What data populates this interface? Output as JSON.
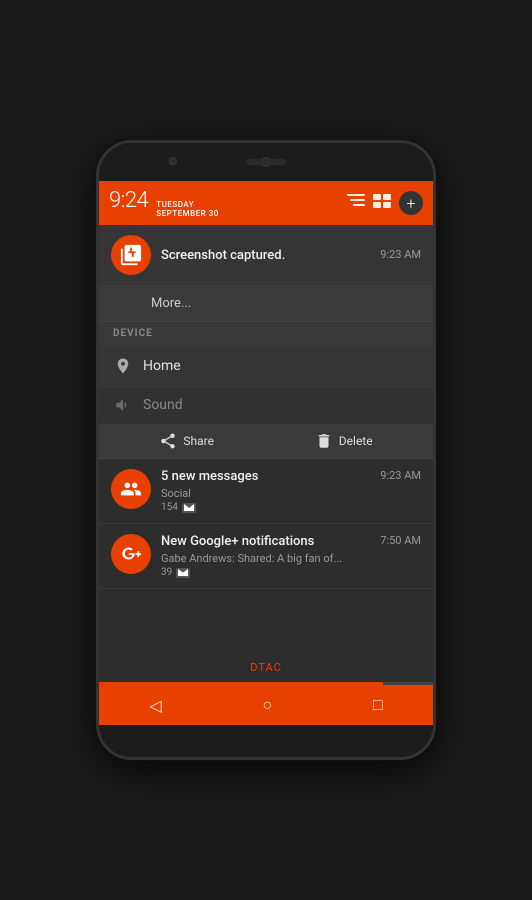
{
  "phone": {
    "status_bar": {
      "time": "9:24",
      "day": "TUESDAY",
      "date": "SEPTEMBER 30",
      "add_label": "+"
    },
    "notifications": {
      "screenshot": {
        "title": "Screenshot captured.",
        "time": "9:23 AM"
      },
      "more_label": "More...",
      "device_section": "DEVICE",
      "home_label": "Home",
      "sound_label": "Sound",
      "share_label": "Share",
      "delete_label": "Delete",
      "messages": {
        "title": "5 new messages",
        "sub": "Social",
        "time": "9:23 AM",
        "count": "154"
      },
      "gplus": {
        "title": "New Google+ notifications",
        "sub": "Gabe Andrews: Shared: A big fan of...",
        "time": "7:50 AM",
        "count": "39"
      }
    },
    "dtac_label": "DTAC",
    "nav": {
      "back": "◁",
      "home": "○",
      "recents": "□"
    }
  }
}
